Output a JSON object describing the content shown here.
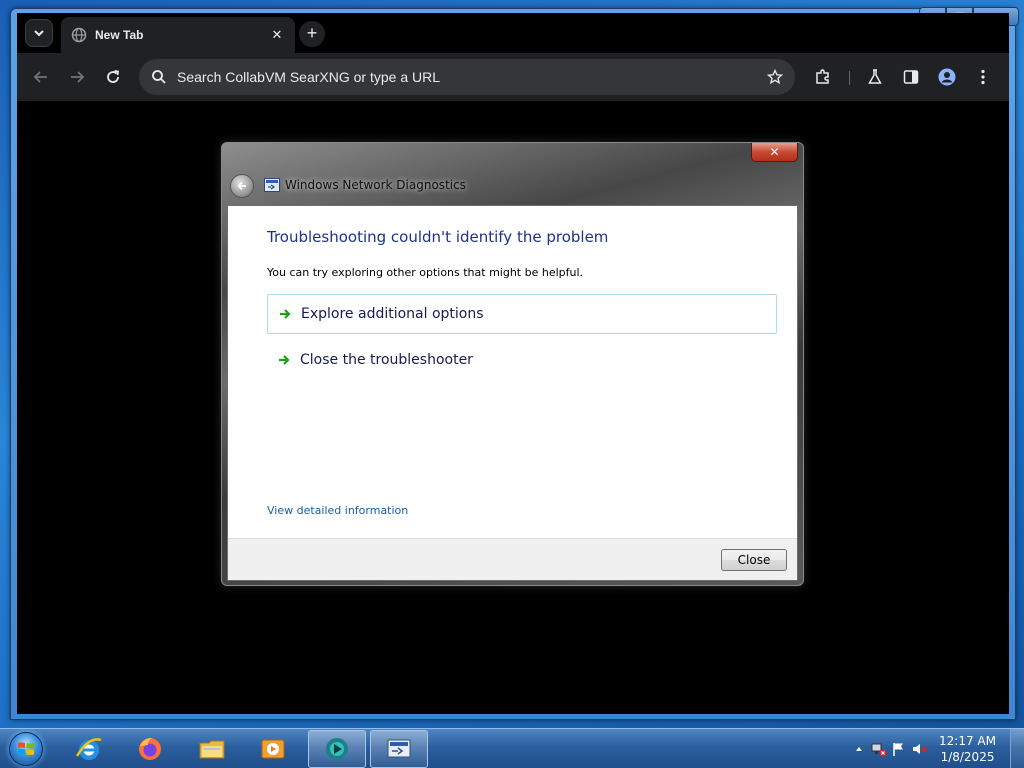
{
  "browser": {
    "tab": {
      "title": "New Tab",
      "close_symbol": "✕"
    },
    "new_tab_symbol": "+",
    "omnibox": {
      "placeholder": "Search CollabVM SearXNG or type a URL"
    }
  },
  "dialog": {
    "title": "Windows Network Diagnostics",
    "heading": "Troubleshooting couldn't identify the problem",
    "subtext": "You can try exploring other options that might be helpful.",
    "options": [
      {
        "label": "Explore additional options"
      },
      {
        "label": "Close the troubleshooter"
      }
    ],
    "detail_link": "View detailed information",
    "close_button": "Close",
    "close_x": "✕"
  },
  "taskbar": {
    "clock_time": "12:17 AM",
    "clock_date": "1/8/2025",
    "apps": [
      "internet-explorer-icon",
      "firefox-icon",
      "file-explorer-icon",
      "media-player-icon",
      "collabvm-app-icon",
      "network-diagnostics-icon"
    ]
  },
  "colors": {
    "dialog_heading": "#1e3287",
    "link": "#1e5ea0",
    "chrome_dark": "#202124"
  }
}
